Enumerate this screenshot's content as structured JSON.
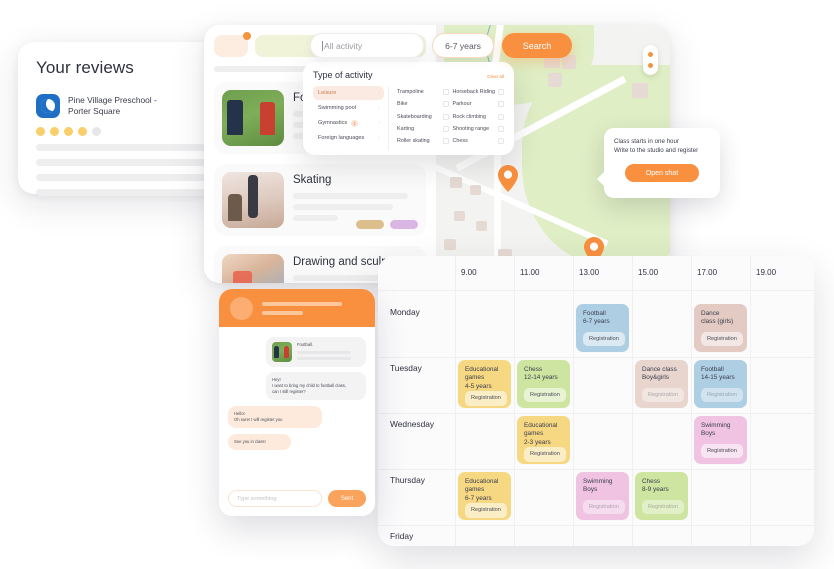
{
  "reviews": {
    "title": "Your reviews",
    "org_name": "Pine Village Preschool -\nPorter Square",
    "org_name_line1": "Pine Village Preschool -",
    "org_name_line2": "Porter Square",
    "rating_filled": 4,
    "rating_total": 5,
    "star_color": "#f8cf6b",
    "logo_color": "#1f6fc4"
  },
  "search": {
    "input_placeholder": "All activity",
    "input_value": "",
    "age_value": "6-7 years",
    "search_label": "Search",
    "accent": "#f9903f"
  },
  "filter": {
    "title": "Type of activity",
    "clear_label": "Clear all",
    "categories": [
      {
        "label": "Leisure",
        "count": null,
        "active": true
      },
      {
        "label": "Swimming pool",
        "count": null,
        "active": false
      },
      {
        "label": "Gymnastics",
        "count": "1",
        "active": false
      },
      {
        "label": "Foreign languages",
        "count": null,
        "active": false
      }
    ],
    "options_col1": [
      "Trampoline",
      "Bike",
      "Skateboarding",
      "Karting",
      "Roller skating"
    ],
    "options_col2": [
      "Horseback Riding",
      "Parkour",
      "Rock climbing",
      "Shooting range",
      "Chess"
    ]
  },
  "activities": [
    {
      "title": "Football",
      "image": "football-photo"
    },
    {
      "title": "Skating",
      "image": "skating-photo"
    },
    {
      "title": "Drawing and sculpture",
      "image": "drawing-photo"
    }
  ],
  "tooltip": {
    "line1": "Class starts in one hour",
    "line2": "Write to the studio and register",
    "button_label": "Open shat"
  },
  "chat": {
    "card_title": "Football.",
    "incoming": "Hey!\nI want to bring my child to football class,\ncan I still register?",
    "incoming_line1": "Hey!",
    "incoming_line2": "I want to bring my child to football class,",
    "incoming_line3": "can I still register?",
    "outgoing_1_line1": "Hello!",
    "outgoing_1_line2": "Oh sure! I will register you",
    "outgoing_2": "See you in class!",
    "input_placeholder": "Type something",
    "send_label": "Sent"
  },
  "schedule": {
    "times": [
      "9.00",
      "11.00",
      "13.00",
      "15.00",
      "17.00",
      "19.00"
    ],
    "days": [
      "Monday",
      "Tuesday",
      "Wednesday",
      "Thursday",
      "Friday"
    ],
    "registration_label": "Registration",
    "events": [
      {
        "day": "Monday",
        "time": "13.00",
        "title": "Football",
        "subtitle": "6-7 years",
        "color": "#aecfe3",
        "faded": false
      },
      {
        "day": "Monday",
        "time": "17.00",
        "title": "Dance",
        "subtitle": "class (girls)",
        "color": "#e3cbc3",
        "faded": false
      },
      {
        "day": "Tuesday",
        "time": "9.00",
        "title": "Educational games",
        "subtitle": "4-5 years",
        "color": "#f6d782",
        "faded": false
      },
      {
        "day": "Tuesday",
        "time": "11.00",
        "title": "Chess",
        "subtitle": "12-14 years",
        "color": "#cde5a0",
        "faded": false
      },
      {
        "day": "Tuesday",
        "time": "15.00",
        "title": "Dance class",
        "subtitle": "Boy&girls",
        "color": "#e8d5ce",
        "faded": true
      },
      {
        "day": "Tuesday",
        "time": "17.00",
        "title": "Football",
        "subtitle": "14-15 years",
        "color": "#aecfe3",
        "faded": true
      },
      {
        "day": "Wednesday",
        "time": "11.00",
        "title": "Educational games",
        "subtitle": "2-3 years",
        "color": "#f6d782",
        "faded": false
      },
      {
        "day": "Wednesday",
        "time": "17.00",
        "title": "Swimming",
        "subtitle": "Boys",
        "color": "#f0c3e3",
        "faded": false
      },
      {
        "day": "Thursday",
        "time": "9.00",
        "title": "Educational games",
        "subtitle": "6-7 years",
        "color": "#f6d782",
        "faded": false
      },
      {
        "day": "Thursday",
        "time": "13.00",
        "title": "Swimming",
        "subtitle": "Boys",
        "color": "#f0c3e3",
        "faded": true
      },
      {
        "day": "Thursday",
        "time": "15.00",
        "title": "Chess",
        "subtitle": "8-9 years",
        "color": "#cde5a0",
        "faded": true
      }
    ]
  }
}
